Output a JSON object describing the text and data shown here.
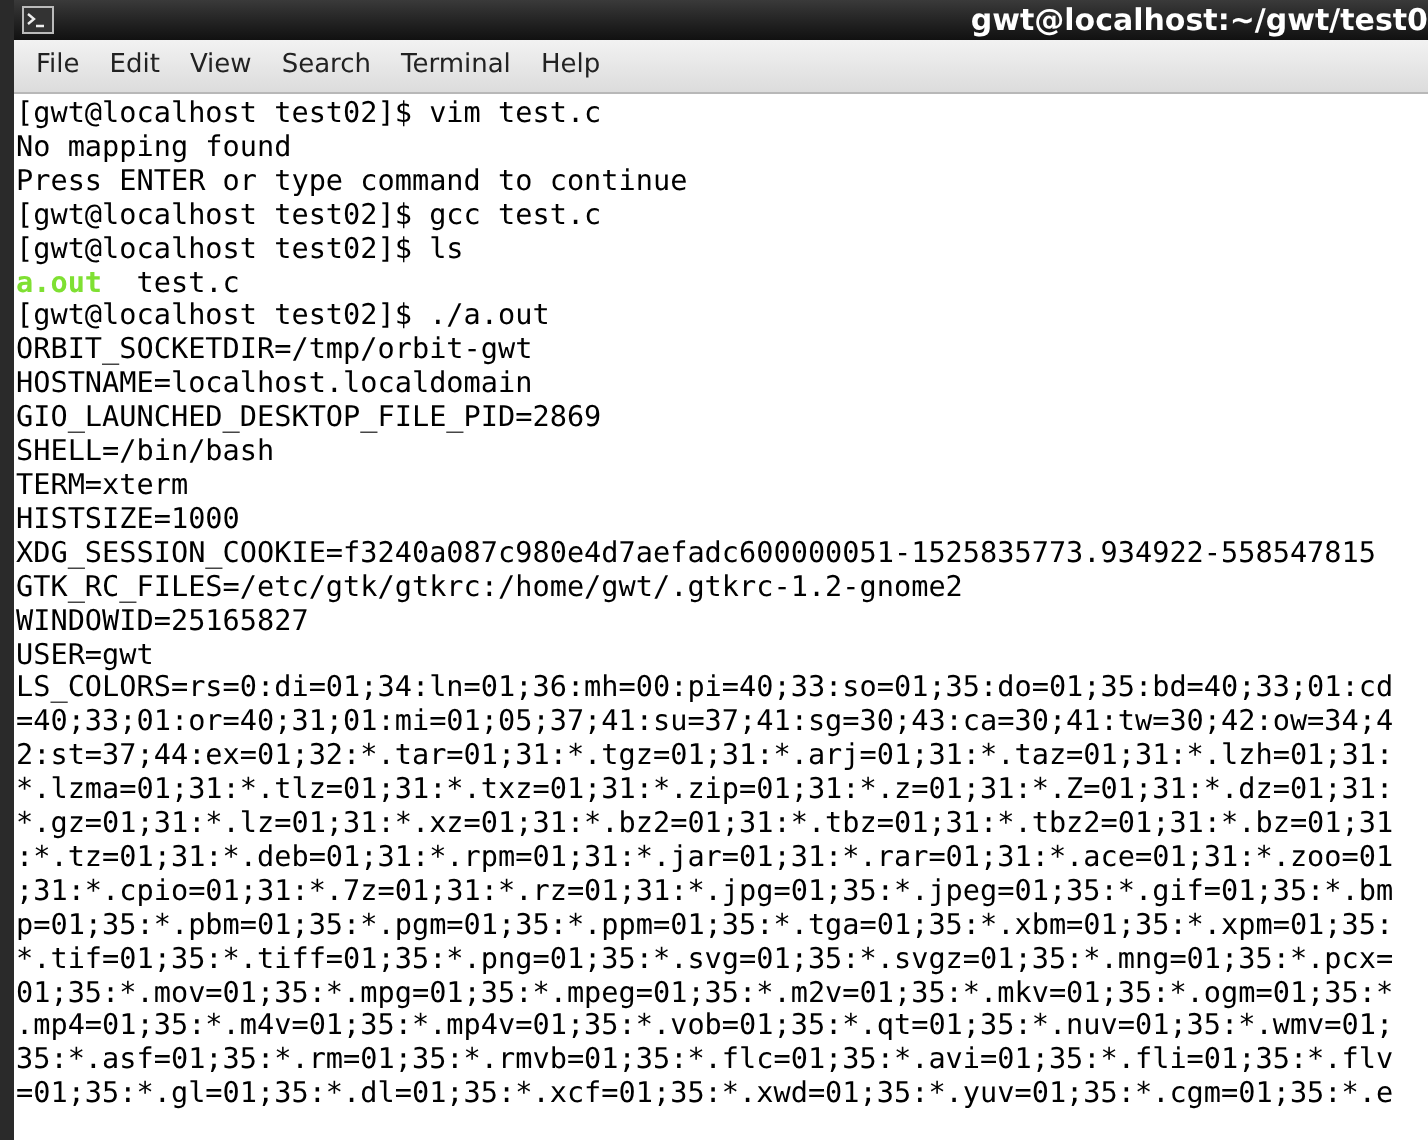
{
  "window": {
    "title": "gwt@localhost:~/gwt/test0"
  },
  "menu": [
    "File",
    "Edit",
    "View",
    "Search",
    "Terminal",
    "Help"
  ],
  "terminal": {
    "lines": [
      {
        "kind": "text",
        "text": "[gwt@localhost test02]$ vim test.c"
      },
      {
        "kind": "text",
        "text": "No mapping found"
      },
      {
        "kind": "text",
        "text": "Press ENTER or type command to continue"
      },
      {
        "kind": "text",
        "text": "[gwt@localhost test02]$ gcc test.c"
      },
      {
        "kind": "text",
        "text": "[gwt@localhost test02]$ ls"
      },
      {
        "kind": "listing",
        "entries": [
          {
            "name": "a.out",
            "color": "#7fe032"
          },
          {
            "name": "test.c",
            "color": "#000000"
          }
        ]
      },
      {
        "kind": "text",
        "text": "[gwt@localhost test02]$ ./a.out"
      },
      {
        "kind": "text",
        "text": "ORBIT_SOCKETDIR=/tmp/orbit-gwt"
      },
      {
        "kind": "text",
        "text": "HOSTNAME=localhost.localdomain"
      },
      {
        "kind": "text",
        "text": "GIO_LAUNCHED_DESKTOP_FILE_PID=2869"
      },
      {
        "kind": "text",
        "text": "SHELL=/bin/bash"
      },
      {
        "kind": "text",
        "text": "TERM=xterm"
      },
      {
        "kind": "text",
        "text": "HISTSIZE=1000"
      },
      {
        "kind": "text",
        "text": "XDG_SESSION_COOKIE=f3240a087c980e4d7aefadc600000051-1525835773.934922-558547815"
      },
      {
        "kind": "text",
        "text": "GTK_RC_FILES=/etc/gtk/gtkrc:/home/gwt/.gtkrc-1.2-gnome2"
      },
      {
        "kind": "text",
        "text": "WINDOWID=25165827"
      },
      {
        "kind": "text",
        "text": "USER=gwt"
      },
      {
        "kind": "text",
        "text": "LS_COLORS=rs=0:di=01;34:ln=01;36:mh=00:pi=40;33:so=01;35:do=01;35:bd=40;33;01:cd"
      },
      {
        "kind": "text",
        "text": "=40;33;01:or=40;31;01:mi=01;05;37;41:su=37;41:sg=30;43:ca=30;41:tw=30;42:ow=34;4"
      },
      {
        "kind": "text",
        "text": "2:st=37;44:ex=01;32:*.tar=01;31:*.tgz=01;31:*.arj=01;31:*.taz=01;31:*.lzh=01;31:"
      },
      {
        "kind": "text",
        "text": "*.lzma=01;31:*.tlz=01;31:*.txz=01;31:*.zip=01;31:*.z=01;31:*.Z=01;31:*.dz=01;31:"
      },
      {
        "kind": "text",
        "text": "*.gz=01;31:*.lz=01;31:*.xz=01;31:*.bz2=01;31:*.tbz=01;31:*.tbz2=01;31:*.bz=01;31"
      },
      {
        "kind": "text",
        "text": ":*.tz=01;31:*.deb=01;31:*.rpm=01;31:*.jar=01;31:*.rar=01;31:*.ace=01;31:*.zoo=01"
      },
      {
        "kind": "text",
        "text": ";31:*.cpio=01;31:*.7z=01;31:*.rz=01;31:*.jpg=01;35:*.jpeg=01;35:*.gif=01;35:*.bm"
      },
      {
        "kind": "text",
        "text": "p=01;35:*.pbm=01;35:*.pgm=01;35:*.ppm=01;35:*.tga=01;35:*.xbm=01;35:*.xpm=01;35:"
      },
      {
        "kind": "text",
        "text": "*.tif=01;35:*.tiff=01;35:*.png=01;35:*.svg=01;35:*.svgz=01;35:*.mng=01;35:*.pcx="
      },
      {
        "kind": "text",
        "text": "01;35:*.mov=01;35:*.mpg=01;35:*.mpeg=01;35:*.m2v=01;35:*.mkv=01;35:*.ogm=01;35:*"
      },
      {
        "kind": "text",
        "text": ".mp4=01;35:*.m4v=01;35:*.mp4v=01;35:*.vob=01;35:*.qt=01;35:*.nuv=01;35:*.wmv=01;"
      },
      {
        "kind": "text",
        "text": "35:*.asf=01;35:*.rm=01;35:*.rmvb=01;35:*.flc=01;35:*.avi=01;35:*.fli=01;35:*.flv"
      },
      {
        "kind": "text",
        "text": "=01;35:*.gl=01;35:*.dl=01;35:*.xcf=01;35:*.xwd=01;35:*.yuv=01;35:*.cgm=01;35:*.e"
      }
    ]
  }
}
